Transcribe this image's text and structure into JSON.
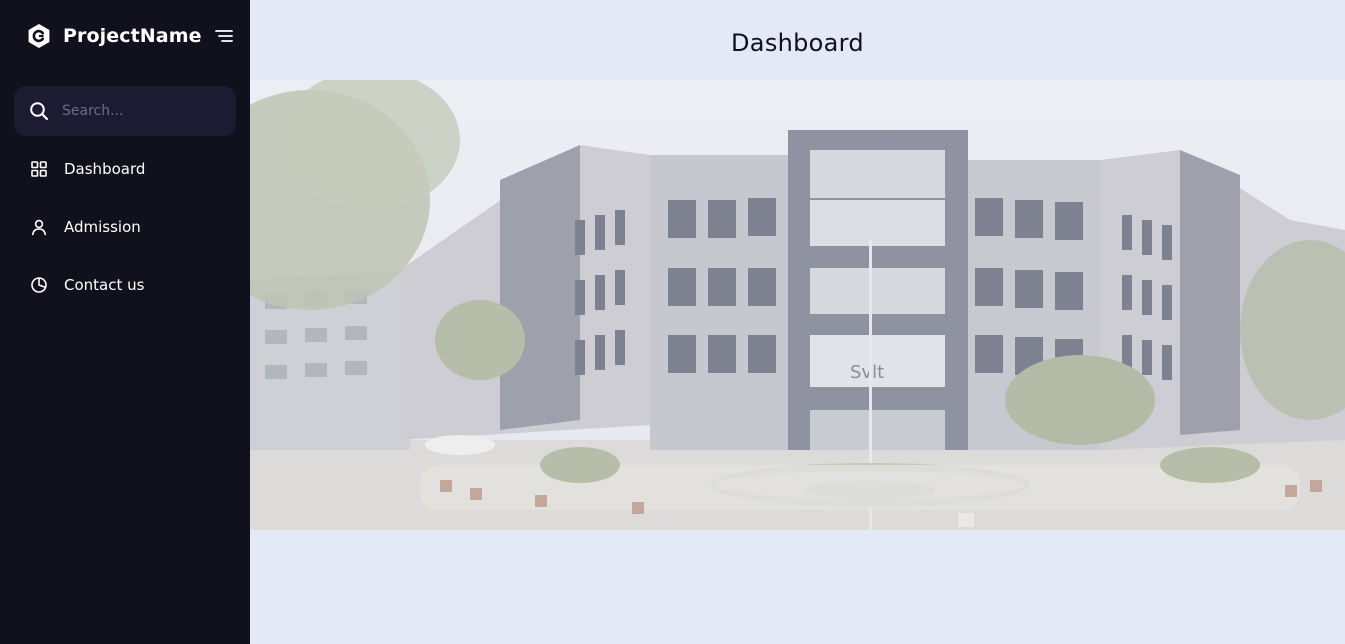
{
  "sidebar": {
    "brand": {
      "name": "ProjectName",
      "logo_icon": "c-hexagon-logo-icon"
    },
    "menu_toggle_icon": "menu-lines-icon",
    "search": {
      "placeholder": "Search...",
      "value": "",
      "icon": "search-icon"
    },
    "items": [
      {
        "label": "Dashboard",
        "icon": "grid-icon"
      },
      {
        "label": "Admission",
        "icon": "user-icon"
      },
      {
        "label": "Contact us",
        "icon": "pie-chart-icon"
      }
    ]
  },
  "main": {
    "title": "Dashboard",
    "banner": {
      "building_sign": "SVIT",
      "description": "Photo of a multi-storey college building with fountain and plants in front"
    }
  },
  "colors": {
    "sidebar_bg": "#11101d",
    "search_bg": "#1d1b31",
    "page_bg": "#e4e9f7",
    "text_light": "#ffffff",
    "text_dark": "#11101d"
  }
}
